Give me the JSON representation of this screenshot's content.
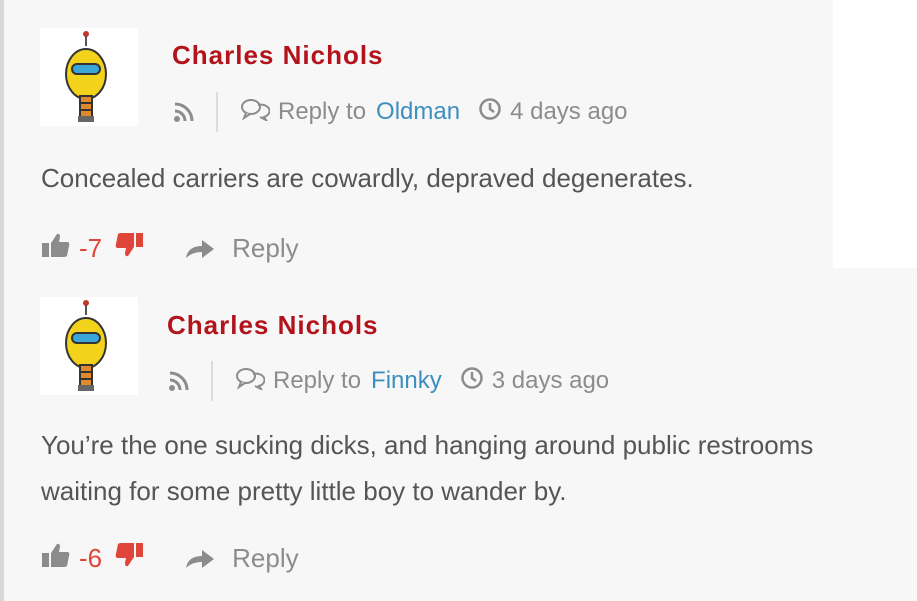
{
  "comments": [
    {
      "author": "Charles Nichols",
      "reply_to_label": "Reply to",
      "reply_to_user": "Oldman",
      "timestamp": "4 days ago",
      "text": "Concealed carriers are cowardly, depraved degenerates.",
      "vote_count": "-7",
      "reply_label": "Reply"
    },
    {
      "author": "Charles Nichols",
      "reply_to_label": "Reply to",
      "reply_to_user": "Finnky",
      "timestamp": "3 days ago",
      "text_line_1": "You’re the one sucking dicks, and hanging around public restrooms",
      "text_line_2": "waiting for some pretty little boy to wander by.",
      "vote_count": "-6",
      "reply_label": "Reply"
    }
  ],
  "icons": {
    "rss": "rss-icon",
    "reply_to": "speech-bubbles-icon",
    "clock": "clock-icon",
    "thumbs_up": "thumbs-up-icon",
    "thumbs_down": "thumbs-down-icon",
    "reply_arrow": "share-arrow-icon"
  },
  "colors": {
    "author": "#b3141b",
    "link": "#3d8fbf",
    "votes": "#e0453a",
    "muted": "#8c8c8c"
  }
}
